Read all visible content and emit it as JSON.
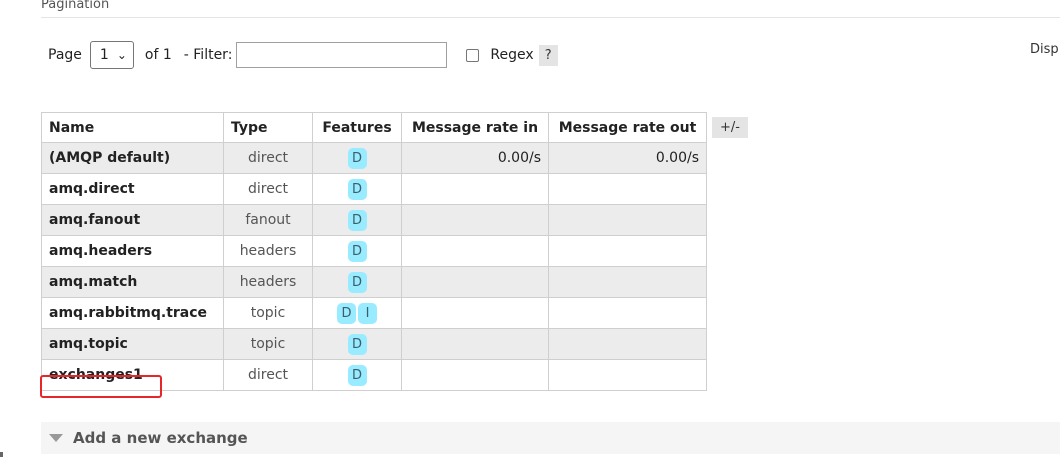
{
  "section": {
    "title": "Pagination"
  },
  "pager": {
    "page_label": "Page",
    "page_value": "1",
    "of_label": "of 1",
    "filter_label": "- Filter:",
    "filter_value": "",
    "filter_placeholder": "",
    "regex_checked": false,
    "regex_label": "Regex",
    "help_label": "?",
    "display_label": "Disp"
  },
  "table": {
    "headers": [
      "Name",
      "Type",
      "Features",
      "Message rate in",
      "Message rate out"
    ],
    "toggle_label": "+/-",
    "rows": [
      {
        "name": "(AMQP default)",
        "type": "direct",
        "features": [
          "D"
        ],
        "rate_in": "0.00/s",
        "rate_out": "0.00/s"
      },
      {
        "name": "amq.direct",
        "type": "direct",
        "features": [
          "D"
        ],
        "rate_in": "",
        "rate_out": ""
      },
      {
        "name": "amq.fanout",
        "type": "fanout",
        "features": [
          "D"
        ],
        "rate_in": "",
        "rate_out": ""
      },
      {
        "name": "amq.headers",
        "type": "headers",
        "features": [
          "D"
        ],
        "rate_in": "",
        "rate_out": ""
      },
      {
        "name": "amq.match",
        "type": "headers",
        "features": [
          "D"
        ],
        "rate_in": "",
        "rate_out": ""
      },
      {
        "name": "amq.rabbitmq.trace",
        "type": "topic",
        "features": [
          "D",
          "I"
        ],
        "rate_in": "",
        "rate_out": ""
      },
      {
        "name": "amq.topic",
        "type": "topic",
        "features": [
          "D"
        ],
        "rate_in": "",
        "rate_out": ""
      },
      {
        "name": "exchanges1",
        "type": "direct",
        "features": [
          "D"
        ],
        "rate_in": "",
        "rate_out": ""
      }
    ]
  },
  "add_exchange": {
    "label": "Add a new exchange"
  },
  "colors": {
    "badge": "#99ebff",
    "highlight": "#e8262a",
    "alt_row": "#ececec"
  }
}
